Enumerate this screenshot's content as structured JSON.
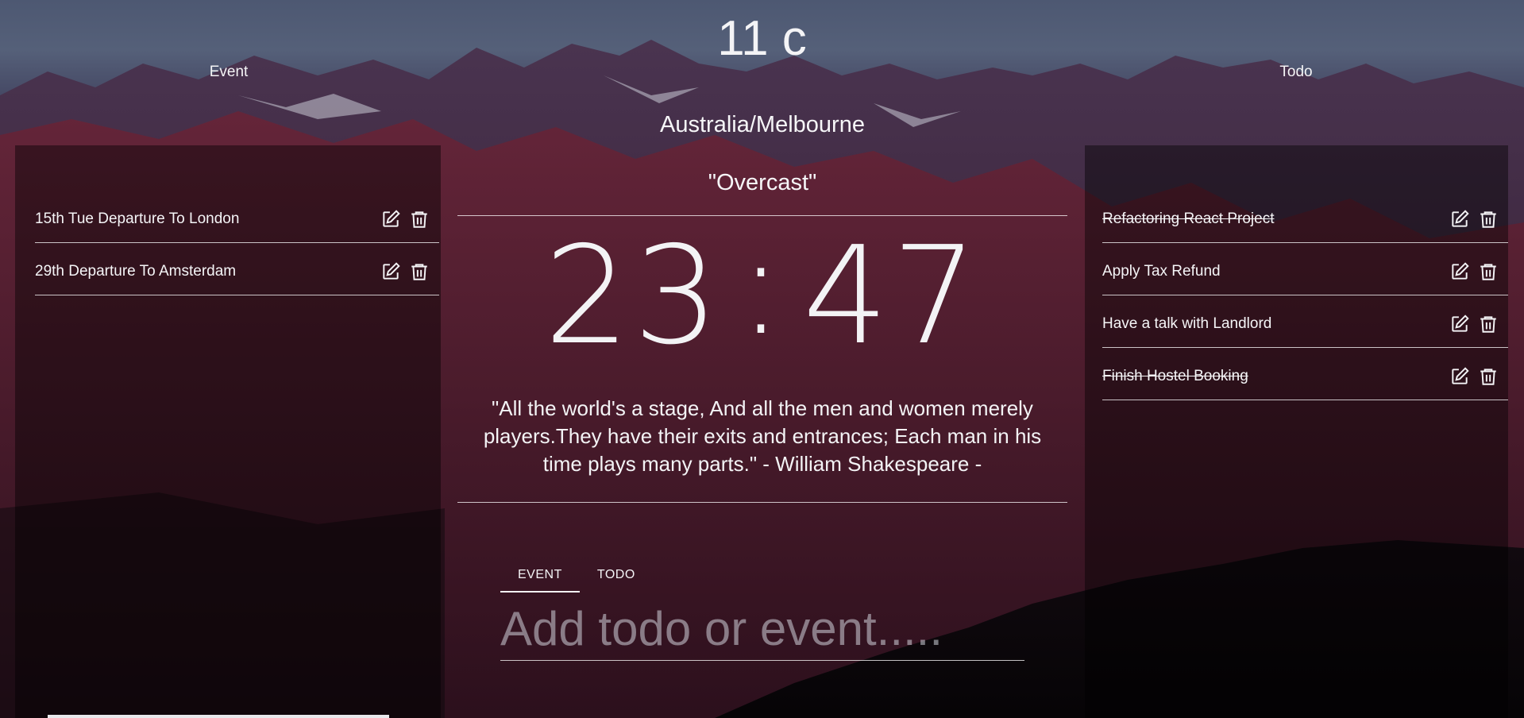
{
  "weather": {
    "temperature": "11 c",
    "location": "Australia/Melbourne",
    "condition": "\"Overcast\""
  },
  "clock": {
    "hours": "23",
    "separator": ":",
    "minutes": "47"
  },
  "quote": "\"All the world's a stage, And all the men and women merely players.They have their exits and entrances; Each man in his time plays many parts.\" - William Shakespeare -",
  "events": {
    "title": "Event",
    "items": [
      {
        "text": "15th Tue Departure To London",
        "done": false
      },
      {
        "text": "29th Departure To Amsterdam",
        "done": false
      }
    ]
  },
  "todos": {
    "title": "Todo",
    "items": [
      {
        "text": "Refactoring React Project",
        "done": true
      },
      {
        "text": "Apply Tax Refund",
        "done": false
      },
      {
        "text": "Have a talk with Landlord",
        "done": false
      },
      {
        "text": "Finish Hostel Booking",
        "done": true
      }
    ]
  },
  "composer": {
    "tabs": [
      {
        "label": "EVENT",
        "active": true
      },
      {
        "label": "TODO",
        "active": false
      }
    ],
    "placeholder": "Add todo or event....."
  },
  "icons": {
    "edit": "edit-icon",
    "delete": "trash-icon"
  }
}
